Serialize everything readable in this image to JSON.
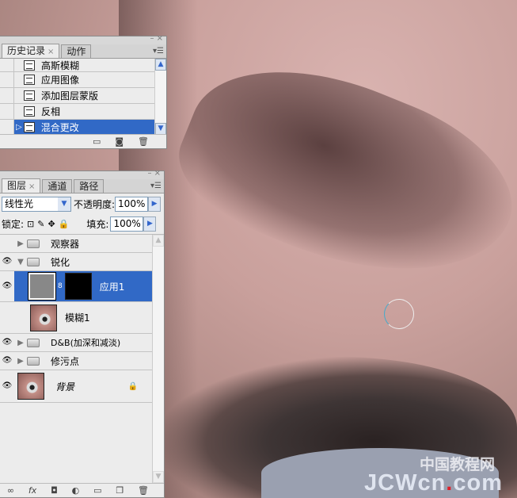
{
  "history": {
    "tabs": [
      "历史记录",
      "动作"
    ],
    "items": [
      {
        "label": "高斯模糊"
      },
      {
        "label": "应用图像"
      },
      {
        "label": "添加图层蒙版"
      },
      {
        "label": "反相"
      },
      {
        "label": "混合更改",
        "selected": true
      }
    ]
  },
  "layers": {
    "tabs": [
      "图层",
      "通道",
      "路径"
    ],
    "blend_mode": "线性光",
    "opacity_label": "不透明度:",
    "opacity": "100%",
    "lock_label": "锁定:",
    "fill_label": "填充:",
    "fill": "100%",
    "items": [
      {
        "name": "观察器"
      },
      {
        "name": "锐化"
      },
      {
        "name": "应用1"
      },
      {
        "name": "模糊1"
      },
      {
        "name": "D&B(加深和减淡)"
      },
      {
        "name": "修污点"
      },
      {
        "name": "背景"
      }
    ],
    "footer_icons": [
      "link-icon",
      "fx-icon",
      "mask-icon",
      "adjustment-icon",
      "folder-icon",
      "new-layer-icon",
      "trash-icon"
    ]
  },
  "watermark": {
    "cn": "中国教程网",
    "en_a": "JCWcn",
    "en_dot": ".",
    "en_b": "com"
  },
  "colors": {
    "selection": "#3169c6"
  }
}
